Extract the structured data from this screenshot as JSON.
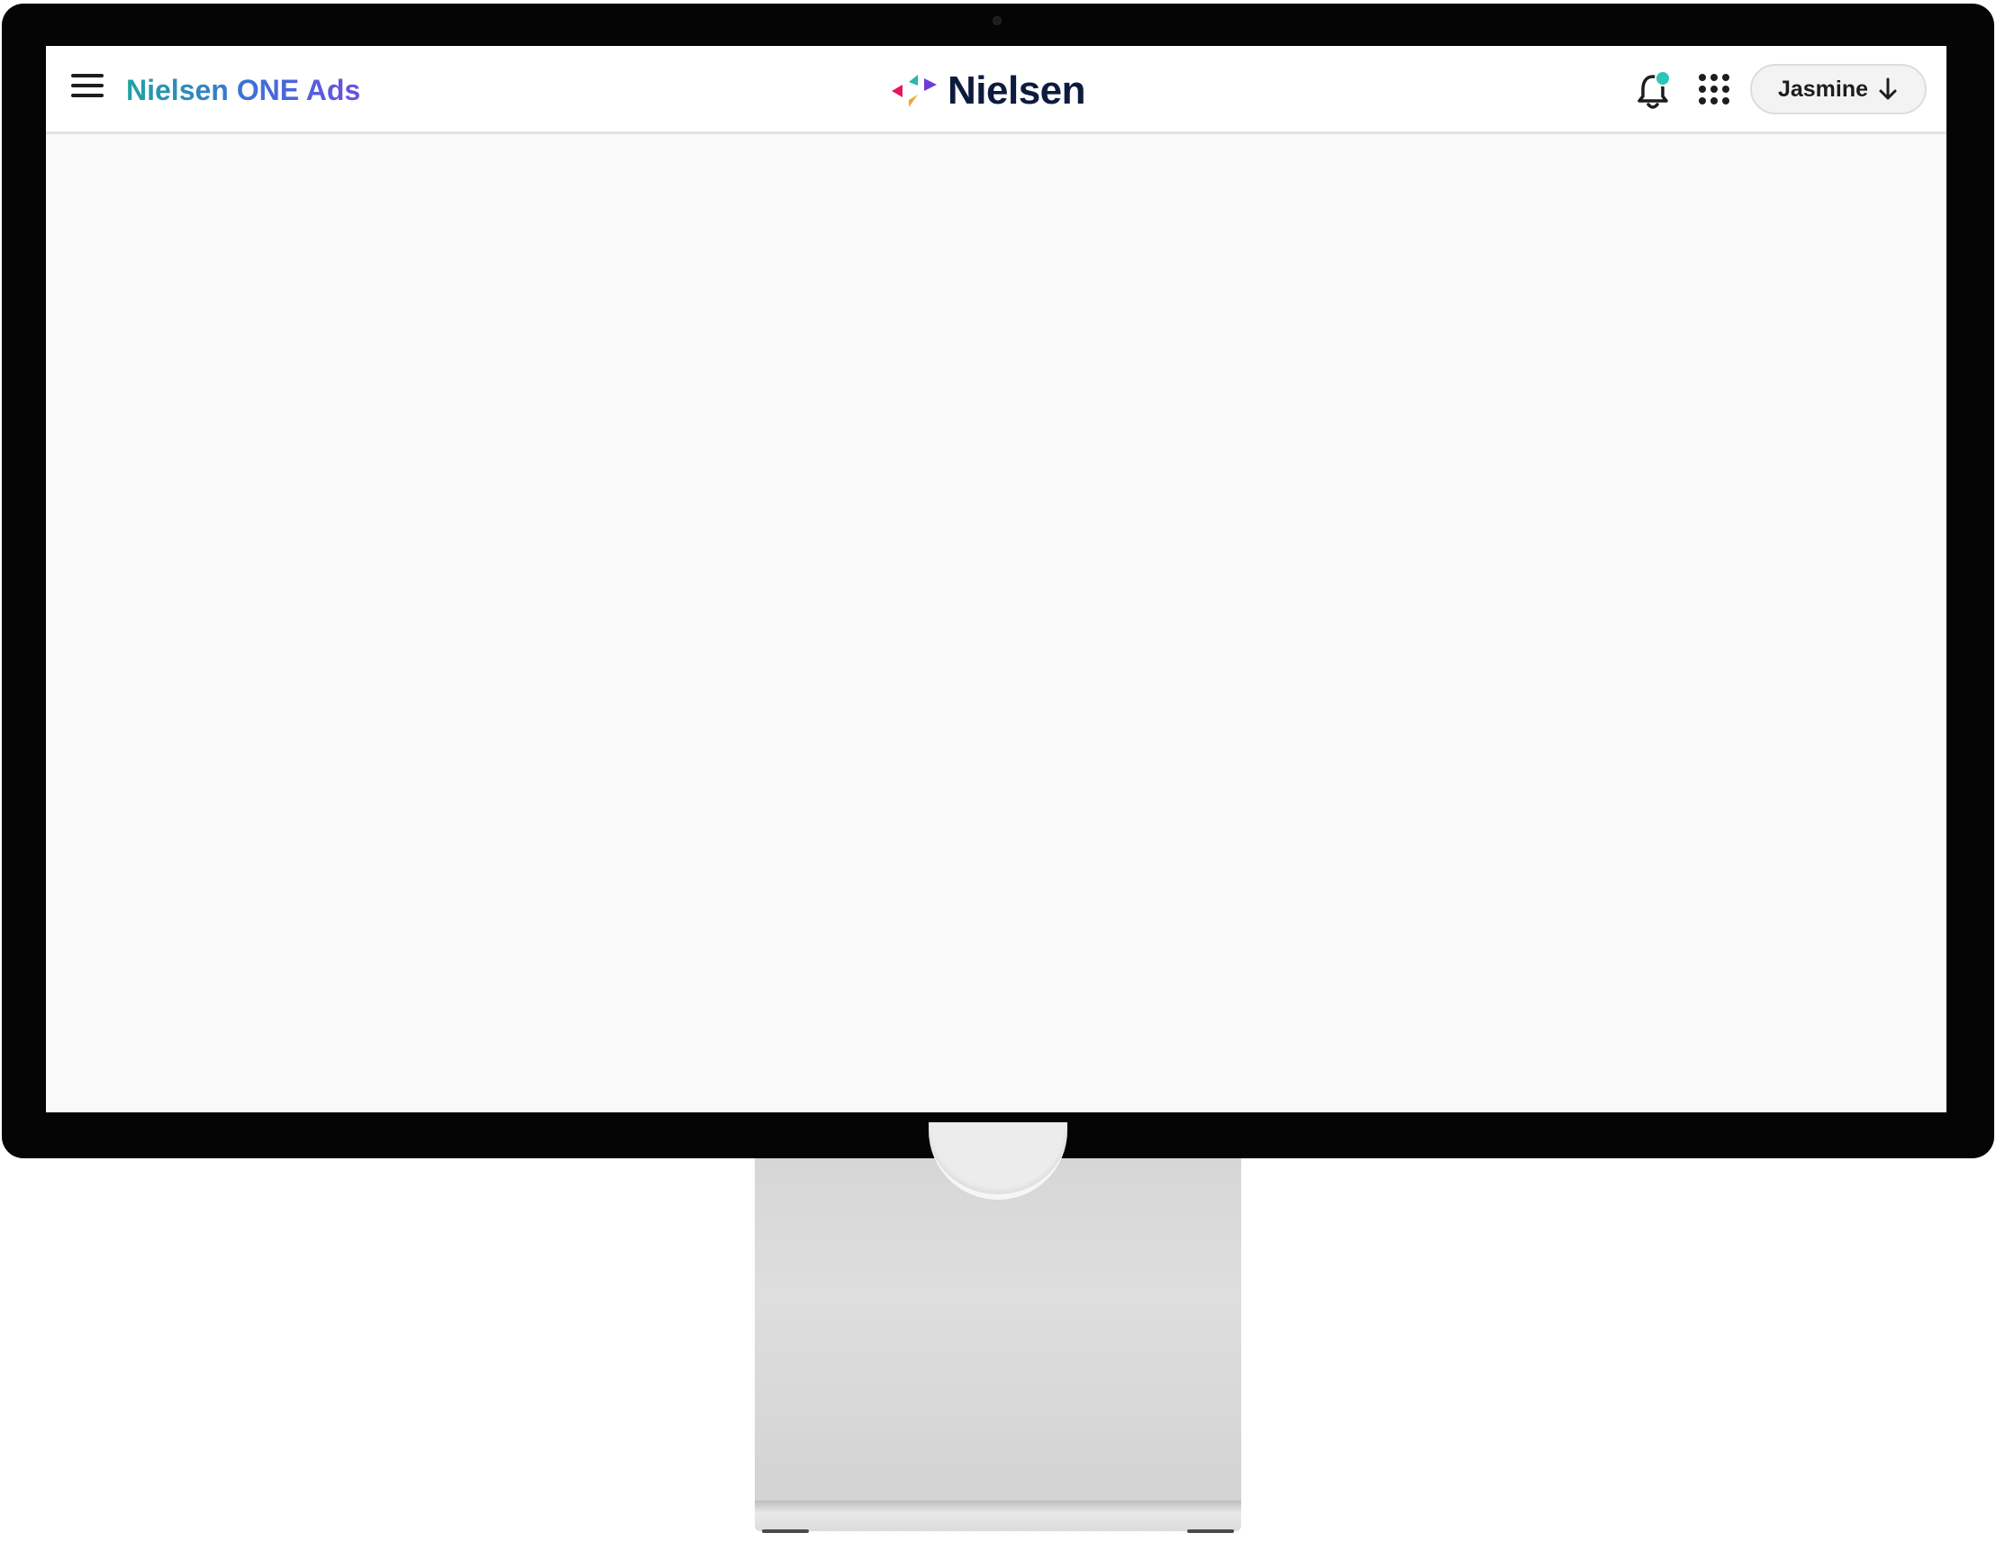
{
  "header": {
    "product_name": "Nielsen ONE Ads",
    "brand_name": "Nielsen",
    "user_name": "Jasmine",
    "notification_dot_color": "#2ec4b6"
  },
  "icons": {
    "menu": "hamburger-menu-icon",
    "bell": "bell-icon",
    "apps": "apps-grid-icon",
    "user_dropdown": "arrow-down-icon"
  },
  "colors": {
    "brand_text": "#0d1b3e",
    "product_gradient": [
      "#1ea3a3",
      "#3f6fd6",
      "#6b4fe0"
    ],
    "screen_background": "#f9f9f9"
  }
}
